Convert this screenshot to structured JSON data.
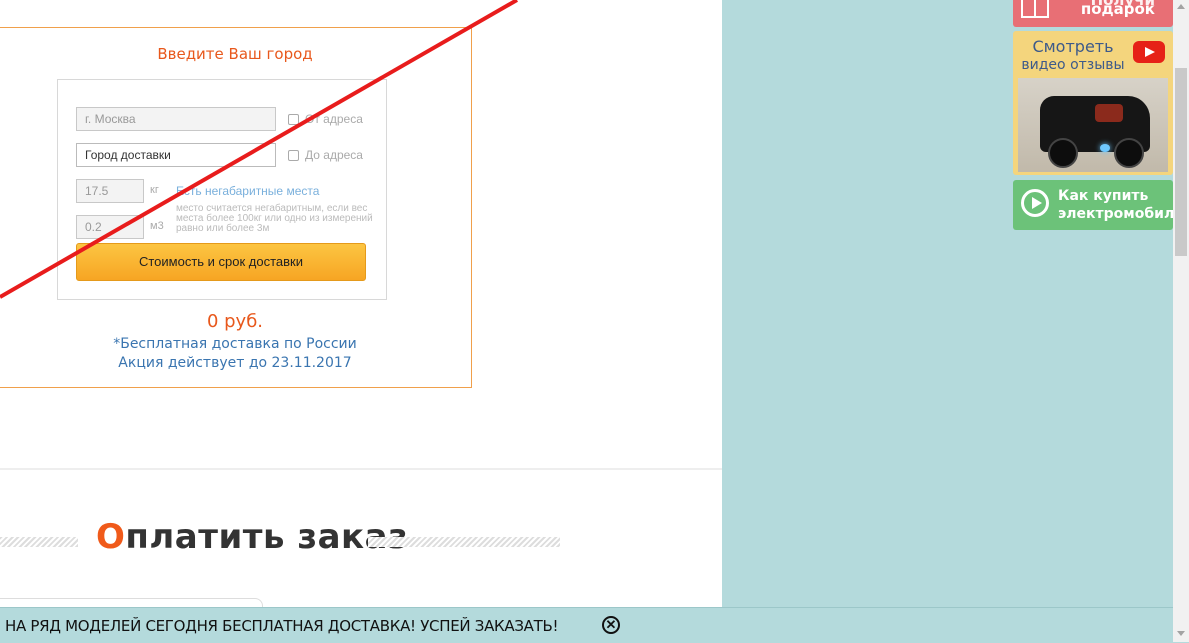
{
  "calc": {
    "title": "Введите Ваш город",
    "from_city": "г. Москва",
    "from_address": "От адреса",
    "to_city_placeholder": "Город доставки",
    "to_address": "До адреса",
    "weight": "17.5",
    "weight_unit": "кг",
    "volume": "0.2",
    "volume_unit": "м3",
    "oversize_link": "Есть негабаритные места",
    "oversize_note": "место считается негабаритным, если вес места более 100кг или одно из измерений равно или более 3м",
    "button": "Стоимость и срок доставки",
    "price": "0 руб.",
    "promo_line1": "*Бесплатная доставка по России",
    "promo_line2": "Акция действует до 23.11.2017"
  },
  "payment": {
    "first_letter": "О",
    "rest": "платить заказ"
  },
  "sidebar": {
    "gift_text": "подарок",
    "gift_text_partial": "Получи",
    "video_line1": "Смотреть",
    "video_line2": "видео отзывы",
    "howbuy_line1": "Как купить",
    "howbuy_line2": "электромобиль?"
  },
  "bottom_bar": {
    "text": "НА РЯД МОДЕЛЕЙ СЕГОДНЯ БЕСПЛАТНАЯ ДОСТАВКА! УСПЕЙ ЗАКАЗАТЬ!",
    "close_symbol": "✕"
  },
  "icons": {
    "gift": "gift-icon",
    "youtube": "youtube-icon",
    "play": "play-icon",
    "close": "close-icon"
  },
  "colors": {
    "accent_orange": "#e8581c",
    "button_orange": "#f7a523",
    "link_blue": "#3a75b0",
    "sidebar_bg": "#b4dadc",
    "gift_red": "#e86f75",
    "video_yellow": "#f4d57d",
    "howbuy_green": "#6cc279"
  }
}
